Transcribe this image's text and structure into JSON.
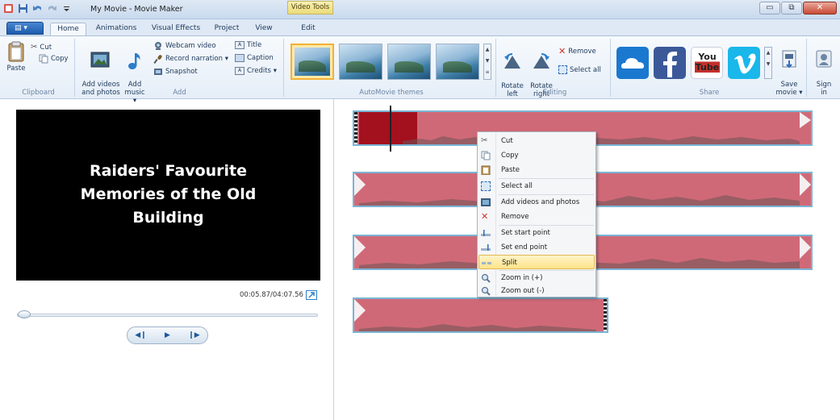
{
  "titlebar": {
    "title": "My Movie - Movie Maker",
    "context_tab": "Video Tools",
    "qat_icons": [
      "movie-maker-app-icon",
      "save-icon",
      "undo-icon",
      "redo-icon",
      "qat-dropdown-icon"
    ]
  },
  "window_controls": {
    "minimize": "▭",
    "maximize": "⧉",
    "close": "✕"
  },
  "tabs": [
    {
      "label": "Home",
      "active": true
    },
    {
      "label": "Animations",
      "active": false
    },
    {
      "label": "Visual Effects",
      "active": false
    },
    {
      "label": "Project",
      "active": false
    },
    {
      "label": "View",
      "active": false
    },
    {
      "label": "Edit",
      "active": false
    }
  ],
  "ribbon": {
    "clipboard": {
      "label": "Clipboard",
      "paste": "Paste",
      "cut": "Cut",
      "copy": "Copy"
    },
    "add": {
      "label": "Add",
      "add_videos": "Add videos\nand photos",
      "add_music": "Add\nmusic ▾",
      "webcam": "Webcam video",
      "narration": "Record narration ▾",
      "snapshot": "Snapshot",
      "title": "Title",
      "caption": "Caption",
      "credits": "Credits ▾"
    },
    "themes": {
      "label": "AutoMovie themes"
    },
    "editing": {
      "label": "Editing",
      "rotate_left": "Rotate\nleft",
      "rotate_right": "Rotate\nright",
      "remove": "Remove",
      "select_all": "Select all"
    },
    "share": {
      "label": "Share",
      "youtube_text": "You\nTube",
      "save_movie": "Save\nmovie ▾",
      "sign_in": "Sign\nin"
    }
  },
  "preview": {
    "text": "Raiders' Favourite\nMemories of the Old\nBuilding",
    "timecode": "00:05.87/04:07.56",
    "seek_fraction": 0.024
  },
  "transport": {
    "prev": "◀❙",
    "play": "▶",
    "next": "❙▶"
  },
  "context_menu": {
    "items": [
      {
        "label": "Cut",
        "icon": "cut-icon"
      },
      {
        "label": "Copy",
        "icon": "copy-icon"
      },
      {
        "label": "Paste",
        "icon": "paste-icon"
      },
      {
        "label": "Select all",
        "icon": "select-all-icon"
      },
      {
        "label": "Add videos and photos",
        "icon": "add-videos-icon"
      },
      {
        "label": "Remove",
        "icon": "remove-icon"
      },
      {
        "label": "Set start point",
        "icon": "set-start-point-icon"
      },
      {
        "label": "Set end point",
        "icon": "set-end-point-icon"
      },
      {
        "label": "Split",
        "icon": "split-icon",
        "highlighted": true
      },
      {
        "label": "Zoom in (+)",
        "icon": "zoom-in-icon"
      },
      {
        "label": "Zoom out (-)",
        "icon": "zoom-out-icon"
      }
    ]
  },
  "colors": {
    "clip_fill": "#d06977",
    "clip_selected": "#a3101e",
    "clip_border": "#7ab4d4",
    "menu_highlight": "#ffe48a"
  }
}
